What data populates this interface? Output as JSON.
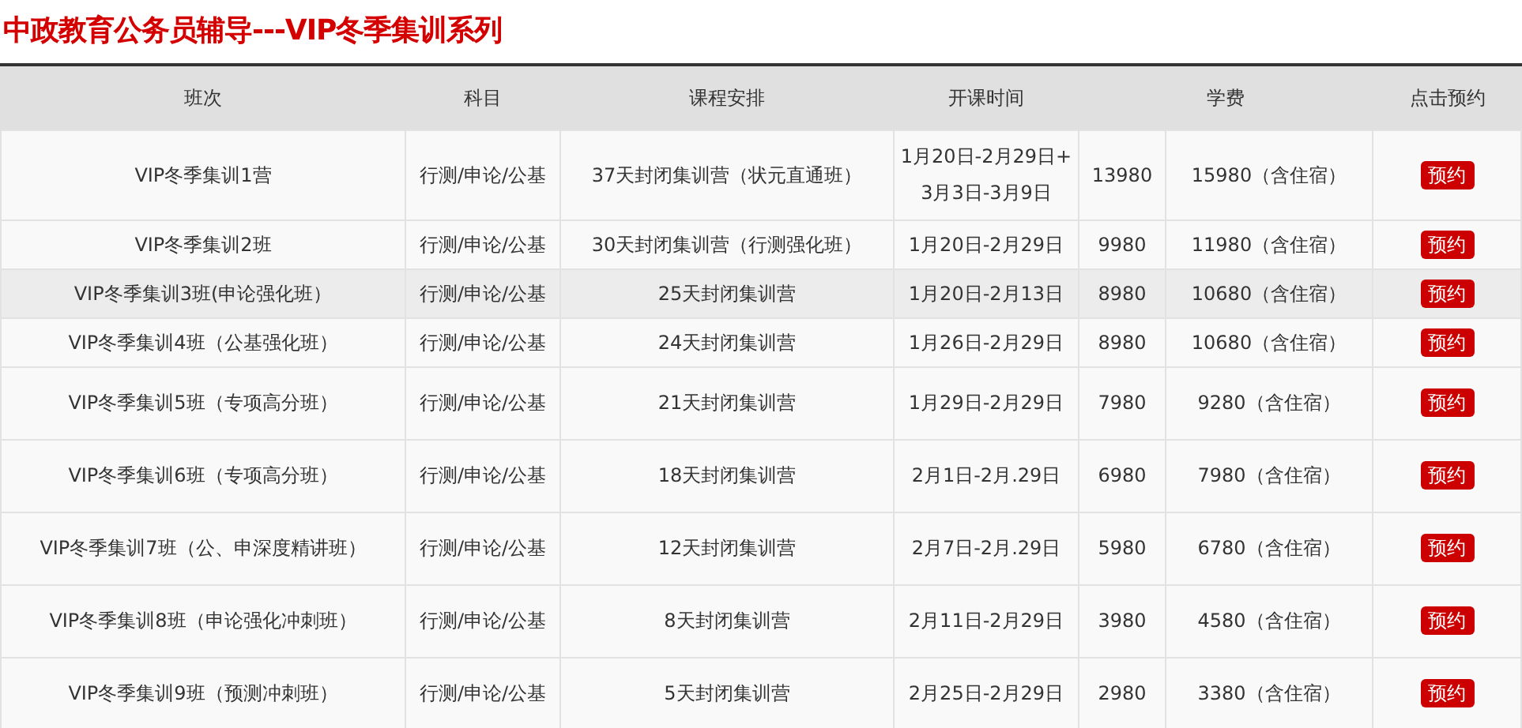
{
  "title": "中政教育公务员辅导---VIP冬季集训系列",
  "table": {
    "columns": [
      "班次",
      "科目",
      "课程安排",
      "开课时间",
      "学费",
      "点击预约"
    ],
    "rows": [
      {
        "class": "VIP冬季集训1营",
        "subjects": "行测/申论/公基",
        "schedule": "37天封闭集训营（状元直通班）",
        "dates": "1月20日-2月29日+3月3日-3月9日",
        "price": "13980",
        "price_lodging": "15980（含住宿）",
        "action": "预约",
        "selected": false
      },
      {
        "class": "VIP冬季集训2班",
        "subjects": "行测/申论/公基",
        "schedule": "30天封闭集训营（行测强化班）",
        "dates": "1月20日-2月29日",
        "price": "9980",
        "price_lodging": "11980（含住宿）",
        "action": "预约",
        "selected": false
      },
      {
        "class": "VIP冬季集训3班(申论强化班）",
        "subjects": "行测/申论/公基",
        "schedule": "25天封闭集训营",
        "dates": "1月20日-2月13日",
        "price": "8980",
        "price_lodging": "10680（含住宿）",
        "action": "预约",
        "selected": true
      },
      {
        "class": "VIP冬季集训4班（公基强化班）",
        "subjects": "行测/申论/公基",
        "schedule": "24天封闭集训营",
        "dates": "1月26日-2月29日",
        "price": "8980",
        "price_lodging": "10680（含住宿）",
        "action": "预约",
        "selected": false
      },
      {
        "class": "VIP冬季集训5班（专项高分班）",
        "subjects": "行测/申论/公基",
        "schedule": "21天封闭集训营",
        "dates": "1月29日-2月29日",
        "price": "7980",
        "price_lodging": "9280（含住宿）",
        "action": "预约",
        "selected": false
      },
      {
        "class": "VIP冬季集训6班（专项高分班）",
        "subjects": "行测/申论/公基",
        "schedule": "18天封闭集训营",
        "dates": "2月1日-2月.29日",
        "price": "6980",
        "price_lodging": "7980（含住宿）",
        "action": "预约",
        "selected": false
      },
      {
        "class": "VIP冬季集训7班（公、申深度精讲班）",
        "subjects": "行测/申论/公基",
        "schedule": "12天封闭集训营",
        "dates": "2月7日-2月.29日",
        "price": "5980",
        "price_lodging": "6780（含住宿）",
        "action": "预约",
        "selected": false
      },
      {
        "class": "VIP冬季集训8班（申论强化冲刺班）",
        "subjects": "行测/申论/公基",
        "schedule": "8天封闭集训营",
        "dates": "2月11日-2月29日",
        "price": "3980",
        "price_lodging": "4580（含住宿）",
        "action": "预约",
        "selected": false
      },
      {
        "class": "VIP冬季集训9班（预测冲刺班）",
        "subjects": "行测/申论/公基",
        "schedule": "5天封闭集训营",
        "dates": "2月25日-2月29日",
        "price": "2980",
        "price_lodging": "3380（含住宿）",
        "action": "预约",
        "selected": false
      }
    ]
  }
}
